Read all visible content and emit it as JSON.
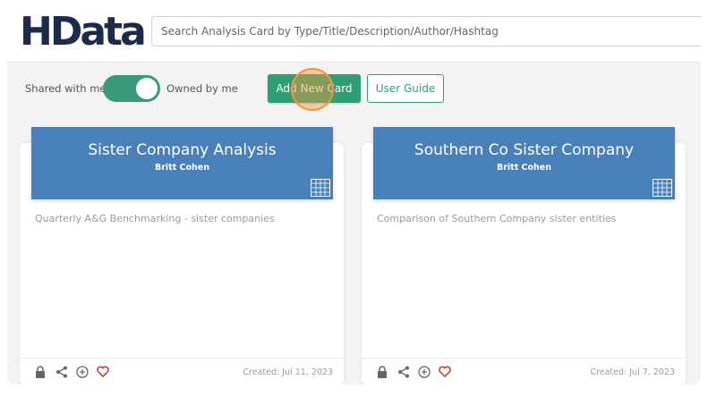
{
  "header": {
    "logo_text": "HData",
    "search_placeholder": "Search Analysis Card by Type/Title/Description/Author/Hashtag"
  },
  "toolbar": {
    "shared_label": "Shared with me",
    "owned_label": "Owned by me",
    "toggle_state": "owned",
    "add_button": "Add New Card",
    "guide_button": "User Guide"
  },
  "cards": [
    {
      "title": "Sister Company Analysis",
      "author": "Britt Cohen",
      "description": "Quarterly A&G Benchmarking - sister companies",
      "created": "Created: Jul 11, 2023"
    },
    {
      "title": "Southern Co Sister Company",
      "author": "Britt Cohen",
      "description": "Comparison of Southern Company sister entities",
      "created": "Created: Jul 7, 2023"
    }
  ],
  "icons": [
    "lock-icon",
    "share-icon",
    "plus-circle-icon",
    "heart-icon",
    "grid-table-icon"
  ],
  "colors": {
    "brand_navy": "#1d2b4a",
    "accent_green": "#2f9e74",
    "toggle_green": "#3a9a7c",
    "card_blue": "#4a80b9",
    "heart_red": "#c0392b"
  }
}
